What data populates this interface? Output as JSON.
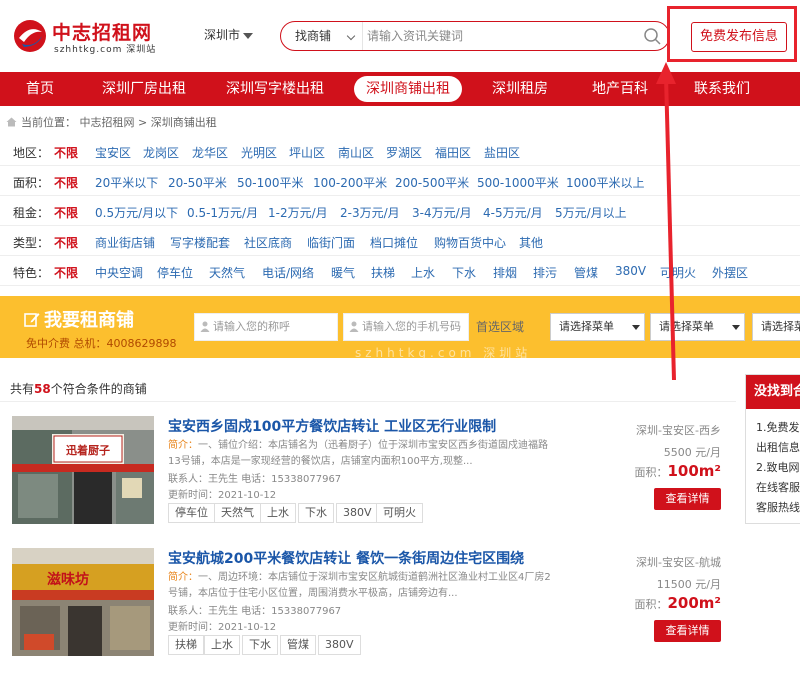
{
  "colors": {
    "brand_red": "#d0111b",
    "link_blue": "#2c6ab1",
    "banner_yellow": "#fcbf2e",
    "annotation_red": "#e8232d"
  },
  "header": {
    "logo_title": "中志招租网",
    "logo_sub": "szhhtkg.com  深圳站",
    "city": "深圳市",
    "search_type": "找商铺",
    "search_placeholder": "请输入资讯关键词",
    "publish_label": "免费发布信息"
  },
  "nav": {
    "items": [
      "首页",
      "深圳厂房出租",
      "深圳写字楼出租",
      "深圳商铺出租",
      "深圳租房",
      "地产百科",
      "联系我们"
    ],
    "active_index": 3
  },
  "breadcrumb": {
    "prefix": "当前位置：",
    "items": [
      "中志招租网",
      ">",
      "深圳商铺出租"
    ]
  },
  "filters": [
    {
      "label": "地区：",
      "options": [
        "不限",
        "宝安区",
        "龙岗区",
        "龙华区",
        "光明区",
        "坪山区",
        "南山区",
        "罗湖区",
        "福田区",
        "盐田区"
      ]
    },
    {
      "label": "面积：",
      "options": [
        "不限",
        "20平米以下",
        "20-50平米",
        "50-100平米",
        "100-200平米",
        "200-500平米",
        "500-1000平米",
        "1000平米以上"
      ]
    },
    {
      "label": "租金：",
      "options": [
        "不限",
        "0.5万元/月以下",
        "0.5-1万元/月",
        "1-2万元/月",
        "2-3万元/月",
        "3-4万元/月",
        "4-5万元/月",
        "5万元/月以上"
      ]
    },
    {
      "label": "类型：",
      "options": [
        "不限",
        "商业街店铺",
        "写字楼配套",
        "社区底商",
        "临街门面",
        "档口摊位",
        "购物百货中心",
        "其他"
      ]
    },
    {
      "label": "特色：",
      "options": [
        "不限",
        "中央空调",
        "停车位",
        "天然气",
        "电话/网络",
        "暖气",
        "扶梯",
        "上水",
        "下水",
        "排烟",
        "排污",
        "管煤",
        "380V",
        "可明火",
        "外摆区"
      ]
    }
  ],
  "want": {
    "title": "我要租商铺",
    "sub": "免中介费 总机：4008629898",
    "name_placeholder": "请输入您的称呼",
    "phone_placeholder": "请输入您的手机号码",
    "district_label": "首选区域",
    "select1": "请选择菜单",
    "select2": "请选择菜单",
    "select3": "请选择菜单"
  },
  "watermark": "szhhtkg.com  深圳站",
  "results": {
    "prefix": "共有",
    "count": "58",
    "suffix": "个符合条件的商铺"
  },
  "listings": [
    {
      "title": "宝安西乡固戍100平方餐饮店转让 工业区无行业限制",
      "desc_key": "简介：",
      "desc": "一、铺位介绍：本店铺名为（迅着厨子）位于深圳市宝安区西乡街道固戍迪福路13号铺，本店是一家现经营的餐饮店，店铺室内面积100平方,现整...",
      "contact": "联系人：王先生 电话：15338077967",
      "update": "更新时间：2021-10-12",
      "tags": [
        "停车位",
        "天然气",
        "上水",
        "下水",
        "380V",
        "可明火"
      ],
      "location": "深圳-宝安区-西乡",
      "price": "5500 元/月",
      "area_label": "面积：",
      "area": "100m²",
      "detail": "查看详情",
      "sign": "迅着厨子"
    },
    {
      "title": "宝安航城200平米餐饮店转让 餐饮一条街周边住宅区围绕",
      "desc_key": "简介：",
      "desc": "一、周边环境：本店铺位于深圳市宝安区航城街道鹤洲社区渔业村工业区4厂房2号铺，本店位于住宅小区位置，周围消费水平极高，店铺旁边有...",
      "contact": "联系人：王先生 电话：15338077967",
      "update": "更新时间：2021-10-12",
      "tags": [
        "扶梯",
        "上水",
        "下水",
        "管煤",
        "380V"
      ],
      "location": "深圳-宝安区-航城",
      "price": "11500 元/月",
      "area_label": "面积：",
      "area": "200m²",
      "detail": "查看详情",
      "sign": "滋味坊"
    }
  ],
  "side": {
    "head": "没找到合",
    "lines": [
      "1.免费发",
      "出租信息",
      "2.致电网",
      "在线客服",
      "客服热线"
    ]
  }
}
